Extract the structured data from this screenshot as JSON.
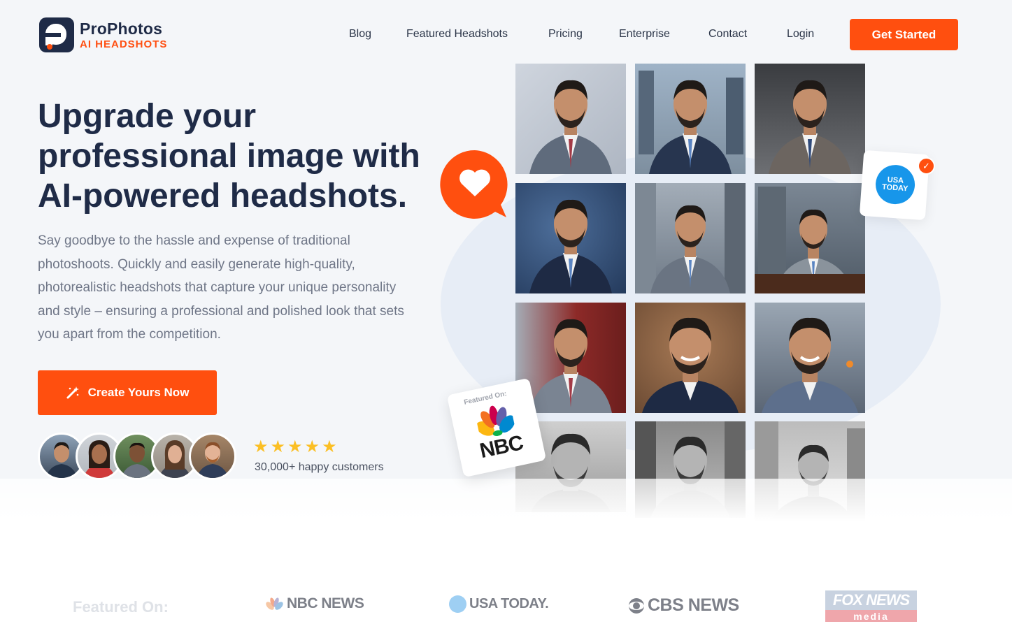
{
  "brand": {
    "title": "ProPhotos",
    "subtitle": "AI HEADSHOTS",
    "accent": "#ff4f0f",
    "navy": "#1f2b47"
  },
  "nav": {
    "items": [
      "Blog",
      "Featured Headshots",
      "Pricing",
      "Enterprise",
      "Contact",
      "Login"
    ],
    "cta": "Get Started"
  },
  "hero": {
    "title": "Upgrade your professional image with AI-powered headshots.",
    "description": "Say goodbye to the hassle and expense of traditional photoshoots. Quickly and easily generate high-quality, photorealistic headshots that capture your unique personality and style – ensuring a professional and polished look that sets you apart from the competition.",
    "cta": "Create Yours Now",
    "rating_stars": 5,
    "customers": "30,000+ happy customers"
  },
  "badges": {
    "usa_today": "USA TODAY",
    "featured_on": "Featured On:",
    "nbc": "NBC"
  },
  "featured": {
    "label": "Featured On:",
    "logos": [
      "NBC NEWS",
      "USA TODAY.",
      "CBS NEWS",
      "FOX NEWS",
      "media"
    ]
  }
}
